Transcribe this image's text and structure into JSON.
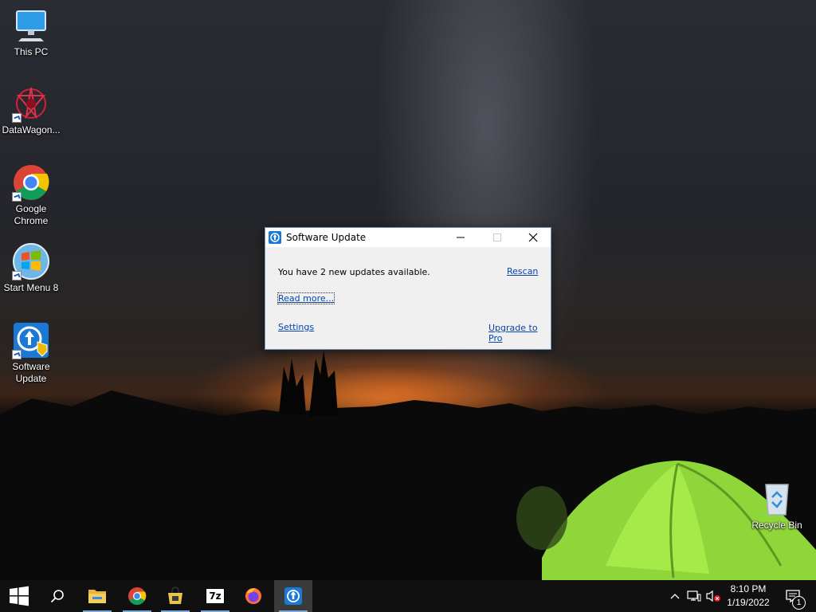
{
  "desktop": {
    "icons": [
      {
        "label": "This PC",
        "icon": "this-pc-icon"
      },
      {
        "label": "DataWagon...",
        "icon": "datawagon-icon"
      },
      {
        "label": "Google Chrome",
        "icon": "chrome-icon"
      },
      {
        "label": "Start Menu 8",
        "icon": "start-menu-8-icon"
      },
      {
        "label": "Software Update",
        "icon": "software-update-icon"
      },
      {
        "label": "Recycle Bin",
        "icon": "recycle-bin-icon"
      }
    ]
  },
  "dialog": {
    "title": "Software Update",
    "message": "You have 2 new updates available.",
    "rescan_label": "Rescan",
    "read_more_label": "Read more...",
    "settings_label": "Settings",
    "upgrade_label": "Upgrade to Pro"
  },
  "taskbar": {
    "apps": [
      {
        "name": "start-button",
        "icon": "windows-logo-icon"
      },
      {
        "name": "search-button",
        "icon": "search-icon"
      },
      {
        "name": "file-explorer",
        "icon": "folder-icon"
      },
      {
        "name": "chrome",
        "icon": "chrome-icon"
      },
      {
        "name": "store",
        "icon": "bag-icon"
      },
      {
        "name": "7zip",
        "icon": "7zip-icon",
        "text": "7z"
      },
      {
        "name": "firefox",
        "icon": "firefox-icon"
      },
      {
        "name": "software-update",
        "icon": "software-update-icon"
      }
    ],
    "clock": {
      "time": "8:10 PM",
      "date": "1/19/2022"
    },
    "notification_count": "1"
  },
  "colors": {
    "link": "#0645ad",
    "taskbar": "#101010",
    "accent": "#1a78d6"
  }
}
